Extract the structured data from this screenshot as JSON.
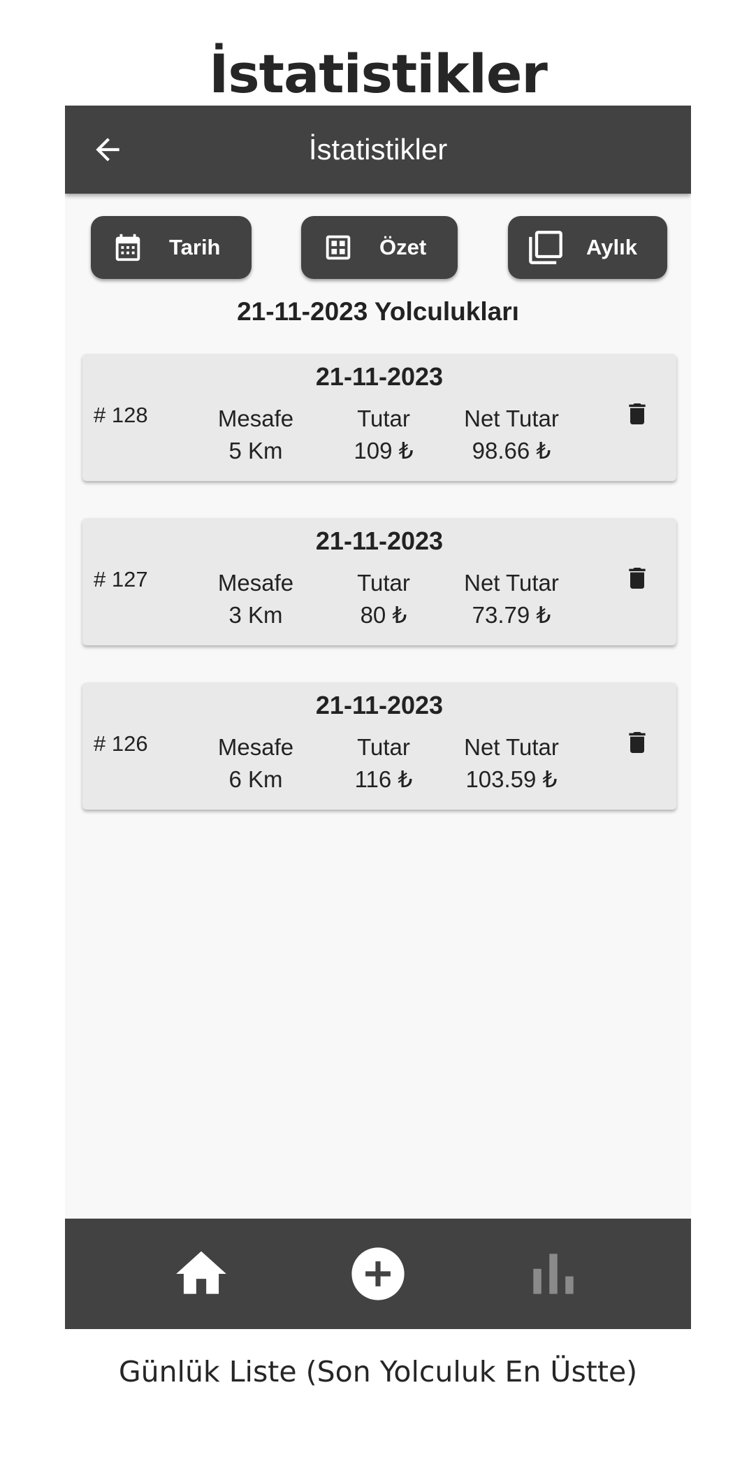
{
  "page_title": "İstatistikler",
  "appbar": {
    "title": "İstatistikler",
    "back_icon": "arrow-left-icon"
  },
  "buttons": {
    "date": {
      "label": "Tarih",
      "icon": "calendar-icon"
    },
    "summary": {
      "label": "Özet",
      "icon": "grid-icon"
    },
    "monthly": {
      "label": "Aylık",
      "icon": "copy-icon"
    }
  },
  "section_title": "21-11-2023 Yolculukları",
  "trips": [
    {
      "date": "21-11-2023",
      "id": "# 128",
      "distance_label": "Mesafe",
      "distance": "5 Km",
      "amount_label": "Tutar",
      "amount": "109 ₺",
      "net_label": "Net Tutar",
      "net": "98.66 ₺"
    },
    {
      "date": "21-11-2023",
      "id": "# 127",
      "distance_label": "Mesafe",
      "distance": "3 Km",
      "amount_label": "Tutar",
      "amount": "80 ₺",
      "net_label": "Net Tutar",
      "net": "73.79 ₺"
    },
    {
      "date": "21-11-2023",
      "id": "# 126",
      "distance_label": "Mesafe",
      "distance": "6 Km",
      "amount_label": "Tutar",
      "amount": "116 ₺",
      "net_label": "Net Tutar",
      "net": "103.59 ₺"
    }
  ],
  "bottom_nav": [
    {
      "icon": "home-icon",
      "active": false
    },
    {
      "icon": "add-circle-icon",
      "active": false
    },
    {
      "icon": "bar-chart-icon",
      "active": true
    }
  ],
  "colors": {
    "bar": "#424242",
    "background": "#f8f8f8",
    "card": "#e9e9e9",
    "inactive_nav": "#8a8a8a"
  },
  "caption": "Günlük Liste (Son Yolculuk En Üstte)"
}
